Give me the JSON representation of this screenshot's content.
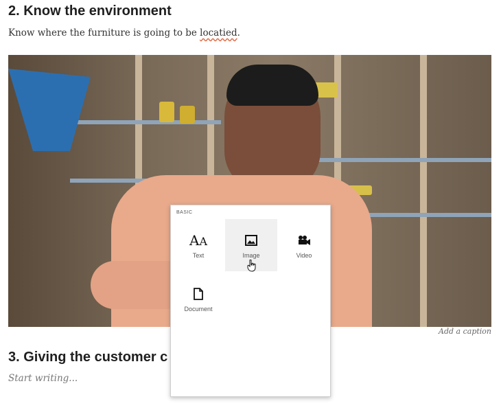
{
  "heading2": "2. Know the environment",
  "para1": {
    "before": "Know where the furniture is going to be ",
    "misspelled": "locatied",
    "after": "."
  },
  "caption": "Add a caption",
  "heading3": "3. Giving the customer c",
  "placeholder": "Start writing...",
  "insert_menu": {
    "section": "BASIC",
    "items": [
      {
        "label": "Text",
        "icon": "text-icon"
      },
      {
        "label": "Image",
        "icon": "image-icon"
      },
      {
        "label": "Video",
        "icon": "video-camera-icon"
      },
      {
        "label": "Document",
        "icon": "document-icon"
      }
    ]
  },
  "colors": {
    "accent_underline": "#e0623a",
    "hover_tile": "#f0f0f0"
  }
}
